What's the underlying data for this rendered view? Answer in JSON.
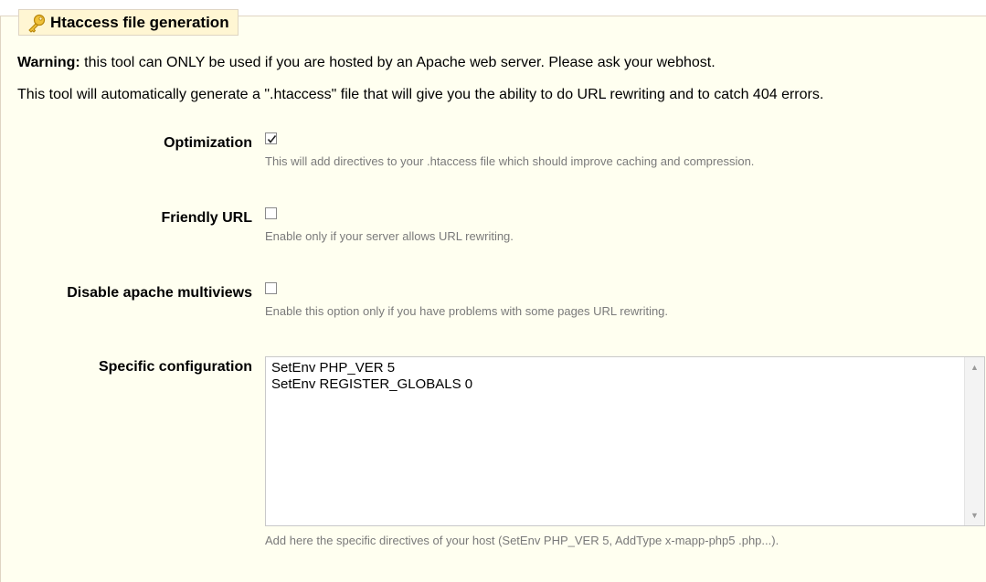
{
  "legend": {
    "title": "Htaccess file generation",
    "icon": "key-icon"
  },
  "warning": {
    "prefix": "Warning:",
    "text": " this tool can ONLY be used if you are hosted by an Apache web server. Please ask your webhost."
  },
  "intro": "This tool will automatically generate a \".htaccess\" file that will give you the ability to do URL rewriting and to catch 404 errors.",
  "options": [
    {
      "label": "Optimization",
      "checked": true,
      "hint": "This will add directives to your .htaccess file which should improve caching and compression."
    },
    {
      "label": "Friendly URL",
      "checked": false,
      "hint": "Enable only if your server allows URL rewriting."
    },
    {
      "label": "Disable apache multiviews",
      "checked": false,
      "hint": "Enable this option only if you have problems with some pages URL rewriting."
    }
  ],
  "specific": {
    "label": "Specific configuration",
    "value": "SetEnv PHP_VER 5\nSetEnv REGISTER_GLOBALS 0",
    "hint": "Add here the specific directives of your host (SetEnv PHP_VER 5, AddType x-mapp-php5 .php...)."
  },
  "colors": {
    "panel_bg": "#fffff0",
    "legend_bg": "#fff6d3",
    "border": "#dfd5c3",
    "hint_text": "#7a7a7a"
  }
}
